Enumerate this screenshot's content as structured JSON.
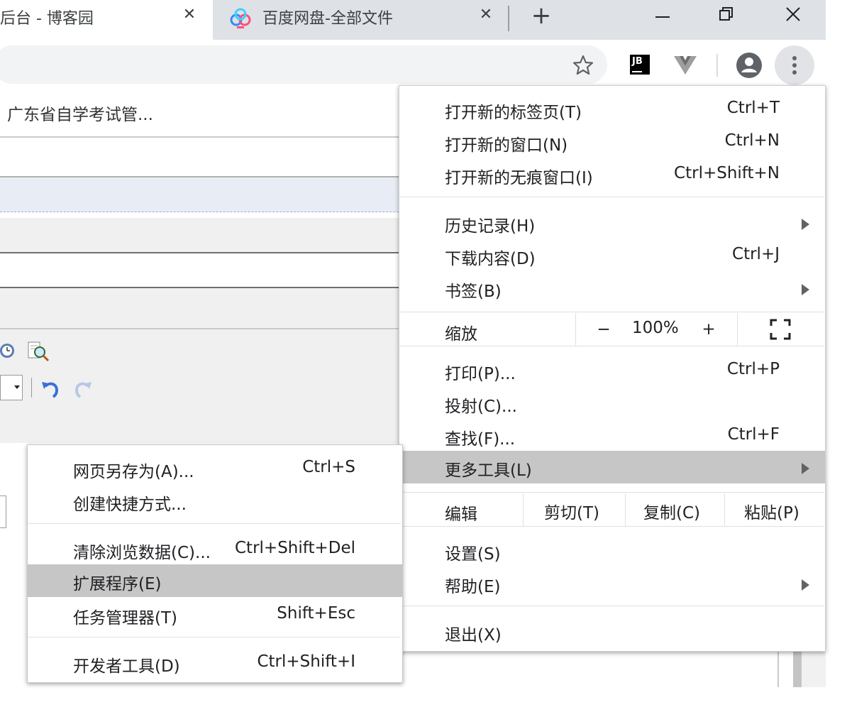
{
  "tabs": [
    {
      "title": "后台 - 博客园",
      "close": "✕"
    },
    {
      "title": "百度网盘-全部文件",
      "close": "✕"
    }
  ],
  "new_tab": "+",
  "page": {
    "link_text": "广东省自学考试管..."
  },
  "main_menu": {
    "items": [
      {
        "label": "打开新的标签页(T)",
        "shortcut": "Ctrl+T"
      },
      {
        "label": "打开新的窗口(N)",
        "shortcut": "Ctrl+N"
      },
      {
        "label": "打开新的无痕窗口(I)",
        "shortcut": "Ctrl+Shift+N"
      },
      {
        "label": "历史记录(H)",
        "shortcut": ""
      },
      {
        "label": "下载内容(D)",
        "shortcut": "Ctrl+J"
      },
      {
        "label": "书签(B)",
        "shortcut": ""
      },
      {
        "label": "打印(P)...",
        "shortcut": "Ctrl+P"
      },
      {
        "label": "投射(C)...",
        "shortcut": ""
      },
      {
        "label": "查找(F)...",
        "shortcut": "Ctrl+F"
      },
      {
        "label": "更多工具(L)",
        "shortcut": ""
      },
      {
        "label": "设置(S)",
        "shortcut": ""
      },
      {
        "label": "帮助(E)",
        "shortcut": ""
      },
      {
        "label": "退出(X)",
        "shortcut": ""
      }
    ],
    "zoom": {
      "label": "缩放",
      "minus": "−",
      "value": "100%",
      "plus": "+"
    },
    "edit": {
      "label": "编辑",
      "cut": "剪切(T)",
      "copy": "复制(C)",
      "paste": "粘贴(P)"
    }
  },
  "sub_menu": {
    "items": [
      {
        "label": "网页另存为(A)...",
        "shortcut": "Ctrl+S"
      },
      {
        "label": "创建快捷方式...",
        "shortcut": ""
      },
      {
        "label": "清除浏览数据(C)...",
        "shortcut": "Ctrl+Shift+Del"
      },
      {
        "label": "扩展程序(E)",
        "shortcut": ""
      },
      {
        "label": "任务管理器(T)",
        "shortcut": "Shift+Esc"
      },
      {
        "label": "开发者工具(D)",
        "shortcut": "Ctrl+Shift+I"
      }
    ]
  },
  "icons": {
    "star": "star-icon",
    "jetbrains": "JB",
    "vue": "vue-devtools-icon",
    "profile": "profile-icon",
    "menu": "more-vert-icon"
  },
  "colors": {
    "highlight": "#c6c6c6",
    "tabstrip": "#dee1e6",
    "omnibox": "#f1f3f4"
  }
}
